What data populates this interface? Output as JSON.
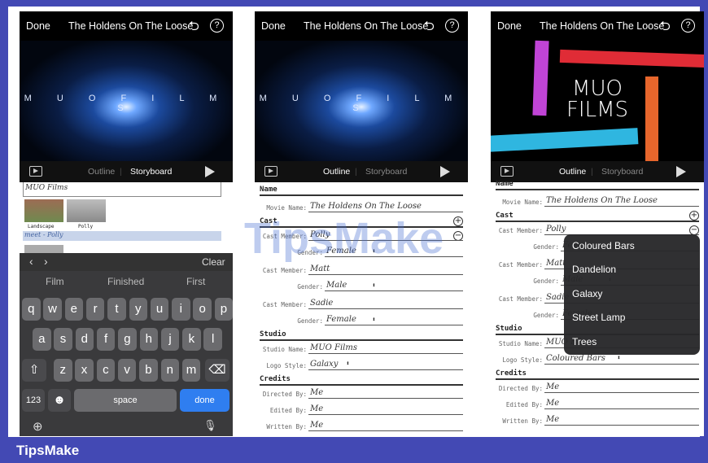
{
  "phones": [
    {
      "title": "The Holdens On The Loose",
      "done": "Done",
      "outline": "Outline",
      "storyboard": "Storyboard",
      "video_logo": "M U O   F I L M S"
    },
    {
      "title": "The Holdens On The Loose",
      "done": "Done",
      "outline": "Outline",
      "storyboard": "Storyboard",
      "video_logo": "M U O   F I L M S"
    },
    {
      "title": "The Holdens On The Loose",
      "done": "Done",
      "outline": "Outline",
      "storyboard": "Storyboard",
      "video_logo": "MUO\nFILMS"
    }
  ],
  "phone1": {
    "field_value": "MUO Films",
    "thumb1": "Landscape",
    "thumb2": "Polly",
    "meet": "meet - Polly",
    "clear": "Clear",
    "suggestions": [
      "Film",
      "Finished",
      "First"
    ],
    "row1": [
      "q",
      "w",
      "e",
      "r",
      "t",
      "y",
      "u",
      "i",
      "o",
      "p"
    ],
    "row2": [
      "a",
      "s",
      "d",
      "f",
      "g",
      "h",
      "j",
      "k",
      "l"
    ],
    "row3": [
      "z",
      "x",
      "c",
      "v",
      "b",
      "n",
      "m"
    ],
    "num": "123",
    "space": "space",
    "done_key": "done"
  },
  "form": {
    "name_h": "Name",
    "cast_h": "Cast",
    "studio_h": "Studio",
    "credits_h": "Credits",
    "movie_label": "Movie Name:",
    "movie_value": "The Holdens On The Loose",
    "cast_label": "Cast Member:",
    "gender_label": "Gender:",
    "cast": [
      {
        "name": "Polly",
        "gender": "Female"
      },
      {
        "name": "Matt",
        "gender": "Male"
      },
      {
        "name": "Sadie",
        "gender": "Female"
      }
    ],
    "studio_label": "Studio Name:",
    "studio_value": "MUO Films",
    "logo_label": "Logo Style:",
    "logo_value2": "Galaxy",
    "logo_value3": "Coloured Bars",
    "directed": "Directed By:",
    "edited": "Edited By:",
    "written": "Written By:",
    "me": "Me"
  },
  "logo_menu": [
    "Coloured Bars",
    "Dandelion",
    "Galaxy",
    "Street Lamp",
    "Trees"
  ],
  "footer": "TipsMake",
  "watermark": "TipsMake"
}
